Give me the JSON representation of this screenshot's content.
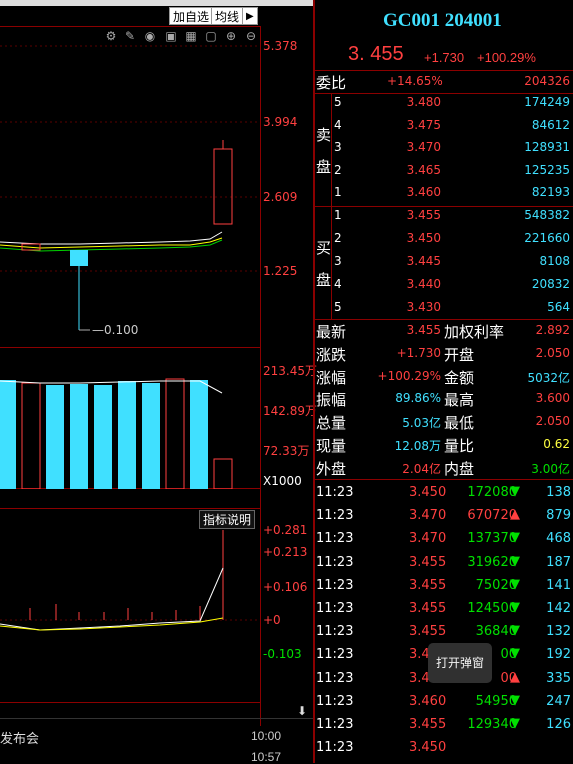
{
  "toolbar": {
    "add_fav": "加自选",
    "ma": "均线",
    "arrow": "▶"
  },
  "kline": {
    "prices": [
      "5.378",
      "3.994",
      "2.609",
      "1.225"
    ],
    "low_label": "0.100"
  },
  "volume": {
    "ticks": [
      "213.45万",
      "142.89万",
      "72.33万"
    ],
    "unit": "X1000"
  },
  "indicator": {
    "button": "指标说明",
    "ticks": [
      "+0.281",
      "+0.213",
      "+0.106",
      "+0",
      "-0.103"
    ]
  },
  "news": {
    "title": "发布会",
    "times": [
      "10:00",
      "10:57"
    ]
  },
  "quote": {
    "code": "GC001 204001",
    "price": "3. 455",
    "change": "+1.730",
    "pct": "+100.29%"
  },
  "weibi": {
    "label": "委比",
    "pct": "+14.65%",
    "value": "204326"
  },
  "sell": {
    "label": [
      "卖",
      "盘"
    ],
    "rows": [
      {
        "n": "5",
        "p": "3.480",
        "v": "174249"
      },
      {
        "n": "4",
        "p": "3.475",
        "v": "84612"
      },
      {
        "n": "3",
        "p": "3.470",
        "v": "128931"
      },
      {
        "n": "2",
        "p": "3.465",
        "v": "125235"
      },
      {
        "n": "1",
        "p": "3.460",
        "v": "82193"
      }
    ]
  },
  "buy": {
    "label": [
      "买",
      "盘"
    ],
    "rows": [
      {
        "n": "1",
        "p": "3.455",
        "v": "548382"
      },
      {
        "n": "2",
        "p": "3.450",
        "v": "221660"
      },
      {
        "n": "3",
        "p": "3.445",
        "v": "8108"
      },
      {
        "n": "4",
        "p": "3.440",
        "v": "20832"
      },
      {
        "n": "5",
        "p": "3.430",
        "v": "564"
      }
    ]
  },
  "stats": [
    {
      "l1": "最新",
      "v1": "3.455",
      "l2": "加权利率",
      "v2": "2.892",
      "c1": "red",
      "c2": "red"
    },
    {
      "l1": "涨跌",
      "v1": "+1.730",
      "l2": "开盘",
      "v2": "2.050",
      "c1": "red",
      "c2": "red"
    },
    {
      "l1": "涨幅",
      "v1": "+100.29%",
      "l2": "金额",
      "v2": "5032亿",
      "c1": "red",
      "c2": "cyan"
    },
    {
      "l1": "振幅",
      "v1": "89.86%",
      "l2": "最高",
      "v2": "3.600",
      "c1": "cyan",
      "c2": "red"
    },
    {
      "l1": "总量",
      "v1": "5.03亿",
      "l2": "最低",
      "v2": "2.050",
      "c1": "cyan",
      "c2": "red"
    },
    {
      "l1": "现量",
      "v1": "12.08万",
      "l2": "量比",
      "v2": "0.62",
      "c1": "cyan",
      "c2": "yellow"
    },
    {
      "l1": "外盘",
      "v1": "2.04亿",
      "l2": "内盘",
      "v2": "3.00亿",
      "c1": "red",
      "c2": "green"
    }
  ],
  "ticks": [
    {
      "t": "11:23",
      "p": "3.450",
      "v": "172080",
      "d": "down",
      "n": "138"
    },
    {
      "t": "11:23",
      "p": "3.470",
      "v": "670720",
      "d": "up",
      "n": "879"
    },
    {
      "t": "11:23",
      "p": "3.470",
      "v": "137370",
      "d": "down",
      "n": "468"
    },
    {
      "t": "11:23",
      "p": "3.455",
      "v": "319620",
      "d": "down",
      "n": "187"
    },
    {
      "t": "11:23",
      "p": "3.455",
      "v": "75020",
      "d": "down",
      "n": "141"
    },
    {
      "t": "11:23",
      "p": "3.455",
      "v": "124500",
      "d": "down",
      "n": "142"
    },
    {
      "t": "11:23",
      "p": "3.455",
      "v": "36840",
      "d": "down",
      "n": "132"
    },
    {
      "t": "11:23",
      "p": "3.4",
      "v": "00",
      "d": "down",
      "n": "192"
    },
    {
      "t": "11:23",
      "p": "3.4",
      "v": "00",
      "d": "up",
      "n": "335"
    },
    {
      "t": "11:23",
      "p": "3.460",
      "v": "54950",
      "d": "down",
      "n": "247"
    },
    {
      "t": "11:23",
      "p": "3.455",
      "v": "129340",
      "d": "down",
      "n": "126"
    },
    {
      "t": "11:23",
      "p": "3.450",
      "v": "",
      "d": "",
      "n": ""
    }
  ],
  "popup": {
    "label": "打开弹窗"
  }
}
